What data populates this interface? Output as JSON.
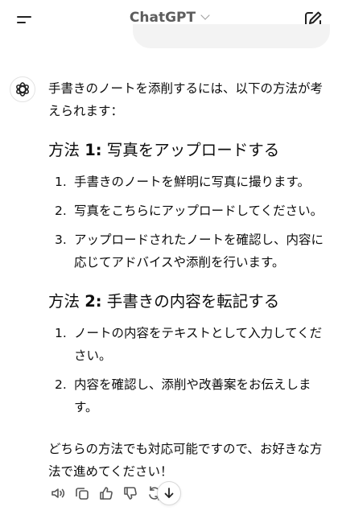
{
  "header": {
    "title": "ChatGPT"
  },
  "message": {
    "intro": "手書きのノートを添削するには、以下の方法が考えられます：",
    "methods": [
      {
        "prefix": "方法 ",
        "number": "1:",
        "heading": " 写真をアップロードする",
        "steps": [
          {
            "num": "1.",
            "text": "手書きのノートを鮮明に写真に撮ります。"
          },
          {
            "num": "2.",
            "text": "写真をこちらにアップロードしてください。"
          },
          {
            "num": "3.",
            "text": "アップロードされたノートを確認し、内容に応じてアドバイスや添削を行います。"
          }
        ]
      },
      {
        "prefix": "方法 ",
        "number": "2:",
        "heading": " 手書きの内容を転記する",
        "steps": [
          {
            "num": "1.",
            "text": "ノートの内容をテキストとして入力してください。"
          },
          {
            "num": "2.",
            "text": "内容を確認し、添削や改善案をお伝えします。"
          }
        ]
      }
    ],
    "closing": "どちらの方法でも対応可能ですので、お好きな方法で進めてください！"
  },
  "icons": {
    "menu": "menu-icon",
    "edit": "edit-icon",
    "logo": "chatgpt-logo-icon",
    "speaker": "speaker-icon",
    "copy": "copy-icon",
    "thumbs_up": "thumbs-up-icon",
    "thumbs_down": "thumbs-down-icon",
    "regenerate": "regenerate-icon",
    "scroll_down": "arrow-down-icon"
  },
  "colors": {
    "title": "#5d5d5d",
    "text": "#0d0d0d",
    "user_bubble": "#f3f3f3"
  }
}
